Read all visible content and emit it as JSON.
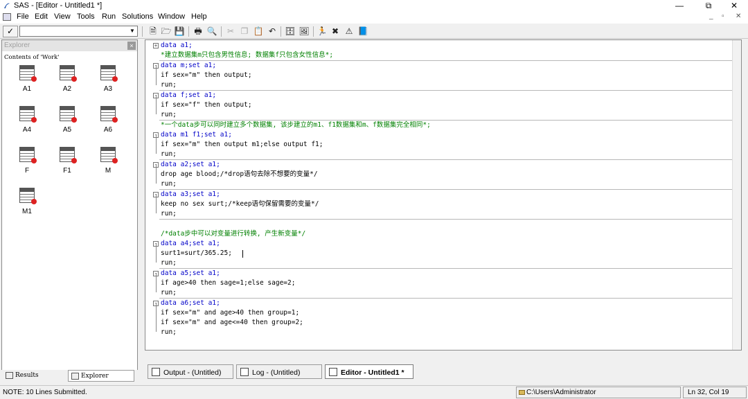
{
  "window": {
    "title": "SAS - [Editor - Untitled1 *]"
  },
  "menu": {
    "items": [
      "File",
      "Edit",
      "View",
      "Tools",
      "Run",
      "Solutions",
      "Window",
      "Help"
    ]
  },
  "explorer": {
    "title": "Explorer",
    "path": "Contents of 'Work'",
    "items": [
      "A1",
      "A2",
      "A3",
      "A4",
      "A5",
      "A6",
      "F",
      "F1",
      "M",
      "M1"
    ],
    "tabs": [
      "Results",
      "Explorer"
    ]
  },
  "editor": {
    "lines": [
      "data a1;",
      "*建立数据集m只包含男性信息; 数据集f只包含女性信息*;",
      "data m;set a1;",
      "if sex=\"m\" then output;",
      "run;",
      "data f;set a1;",
      "if sex=\"f\" then output;",
      "run;",
      "*一个data步可以同时建立多个数据集, 该步建立的m1、f1数据集和m、f数据集完全相同*;",
      "data m1 f1;set a1;",
      "if sex=\"m\" then output m1;else output f1;",
      "run;",
      "data a2;set a1;",
      "drop age blood;/*drop语句去除不想要的变量*/",
      "run;",
      "data a3;set a1;",
      "keep no sex surt;/*keep语句保留需要的变量*/",
      "run;",
      "",
      "/*data步中可以对变量进行转换, 产生新变量*/",
      "data a4;set a1;",
      "surt1=surt/365.25;",
      "run;",
      "data a5;set a1;",
      "if age>40 then sage=1;else sage=2;",
      "run;",
      "data a6;set a1;",
      "if sex=\"m\" and age>40 then group=1;",
      "if sex=\"m\" and age<=40 then group=2;",
      "run;"
    ]
  },
  "window_tabs": [
    "Output - (Untitled)",
    "Log - (Untitled)",
    "Editor - Untitled1 *"
  ],
  "status": {
    "note": "NOTE:  10 Lines Submitted.",
    "path": "C:\\Users\\Administrator",
    "position": "Ln 32, Col 19"
  }
}
